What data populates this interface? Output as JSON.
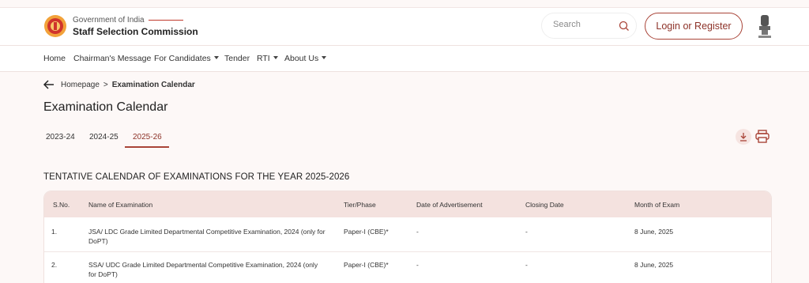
{
  "header": {
    "org_line": "Government of India",
    "org_name": "Staff Selection Commission",
    "search_placeholder": "Search",
    "login_label": "Login or Register"
  },
  "nav": [
    {
      "label": "Home",
      "has_caret": false
    },
    {
      "label": "Chairman's Message",
      "has_caret": false
    },
    {
      "label": "For Candidates",
      "has_caret": true
    },
    {
      "label": "Tender",
      "has_caret": false
    },
    {
      "label": "RTI",
      "has_caret": true
    },
    {
      "label": "About Us",
      "has_caret": true
    }
  ],
  "breadcrumb": {
    "home": "Homepage",
    "separator": ">",
    "current": "Examination Calendar"
  },
  "page_title": "Examination Calendar",
  "tabs": [
    {
      "label": "2023-24",
      "active": false
    },
    {
      "label": "2024-25",
      "active": false
    },
    {
      "label": "2025-26",
      "active": true
    }
  ],
  "section_title": "TENTATIVE CALENDAR OF EXAMINATIONS FOR THE YEAR 2025-2026",
  "table": {
    "headers": [
      "S.No.",
      "Name of Examination",
      "Tier/Phase",
      "Date of Advertisement",
      "Closing Date",
      "Month of Exam"
    ],
    "rows": [
      {
        "sno": "1.",
        "name": "JSA/ LDC Grade Limited Departmental Competitive Examination, 2024 (only for DoPT)",
        "tier": "Paper-I (CBE)*",
        "advert": "-",
        "closing": "-",
        "month": "8 June, 2025"
      },
      {
        "sno": "2.",
        "name": "SSA/ UDC Grade Limited Departmental Competitive Examination, 2024 (only for DoPT)",
        "tier": "Paper-I (CBE)*",
        "advert": "-",
        "closing": "-",
        "month": "8 June, 2025"
      }
    ]
  },
  "colors": {
    "accent": "#a94438",
    "header_row": "#f4e2df",
    "page_bg": "#fdf8f7"
  },
  "icons": [
    "ssc-logo-icon",
    "search-icon",
    "national-emblem-icon",
    "back-arrow-icon",
    "download-icon",
    "print-icon",
    "caret-down-icon"
  ]
}
